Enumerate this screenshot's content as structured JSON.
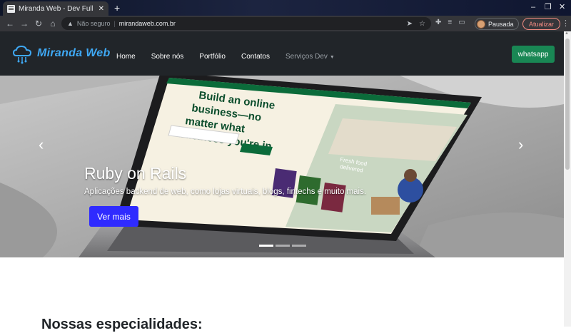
{
  "browser": {
    "tab_title": "Miranda Web - Dev Full St",
    "tab_close": "✕",
    "new_tab": "+",
    "window_controls": [
      "–",
      "❐",
      "✕"
    ],
    "not_secure": "Não seguro",
    "url": "mirandaweb.com.br",
    "profile_label": "Pausada",
    "update_label": "Atualizar"
  },
  "navbar": {
    "brand": "Miranda Web",
    "links": [
      "Home",
      "Sobre nós",
      "Portfólio",
      "Contatos"
    ],
    "dropdown": "Serviços Dev",
    "whatsapp": "whatsapp"
  },
  "hero": {
    "title": "Ruby on Rails",
    "subtitle": "Aplicações backend de web, como lojas virtuais, blogs, fintechs e muito mais.",
    "button": "Ver mais",
    "prev_arrow": "‹",
    "next_arrow": "›",
    "slide_count": 3,
    "active_slide": 1,
    "screen_headline": "Build an online business—no matter what business you're in",
    "screen_caption": "Fresh food delivered"
  },
  "content": {
    "section_title": "Nossas especialidades:"
  },
  "colors": {
    "navbar_bg": "#212529",
    "brand": "#3fa9f5",
    "whatsapp": "#198754",
    "hero_button": "#2f2bff"
  }
}
